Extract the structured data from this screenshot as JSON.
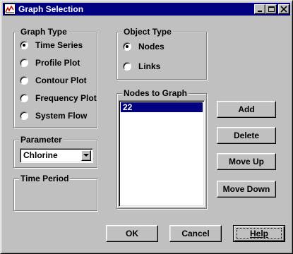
{
  "window": {
    "title": "Graph Selection",
    "colors": {
      "titlebar": "#000080",
      "face": "#c0c0c0",
      "selection": "#000080"
    }
  },
  "graph_type": {
    "label": "Graph Type",
    "options": [
      {
        "label": "Time Series",
        "selected": true
      },
      {
        "label": "Profile Plot",
        "selected": false
      },
      {
        "label": "Contour Plot",
        "selected": false
      },
      {
        "label": "Frequency Plot",
        "selected": false
      },
      {
        "label": "System Flow",
        "selected": false
      }
    ]
  },
  "parameter": {
    "label": "Parameter",
    "value": "Chlorine"
  },
  "time_period": {
    "label": "Time Period"
  },
  "object_type": {
    "label": "Object Type",
    "options": [
      {
        "label": "Nodes",
        "selected": true
      },
      {
        "label": "Links",
        "selected": false
      }
    ]
  },
  "nodes_to_graph": {
    "label": "Nodes to Graph",
    "items": [
      "22"
    ]
  },
  "side_buttons": {
    "add": "Add",
    "delete": "Delete",
    "move_up": "Move Up",
    "move_down": "Move Down"
  },
  "footer_buttons": {
    "ok": "OK",
    "cancel": "Cancel",
    "help": "Help"
  }
}
